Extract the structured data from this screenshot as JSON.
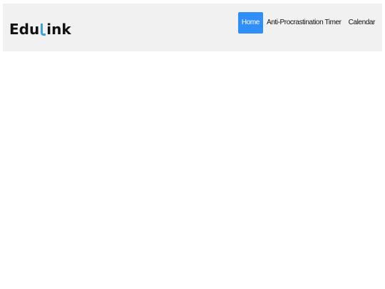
{
  "header": {
    "logo": {
      "part1": "Edu",
      "part2": "ink",
      "accent_color": "#3ea0dc"
    },
    "nav": {
      "items": [
        {
          "label": "Home",
          "active": true
        },
        {
          "label": "Anti-Procrastination Timer",
          "active": false
        },
        {
          "label": "Calendar",
          "active": false
        }
      ],
      "active_color": "#2f8ef7"
    }
  }
}
